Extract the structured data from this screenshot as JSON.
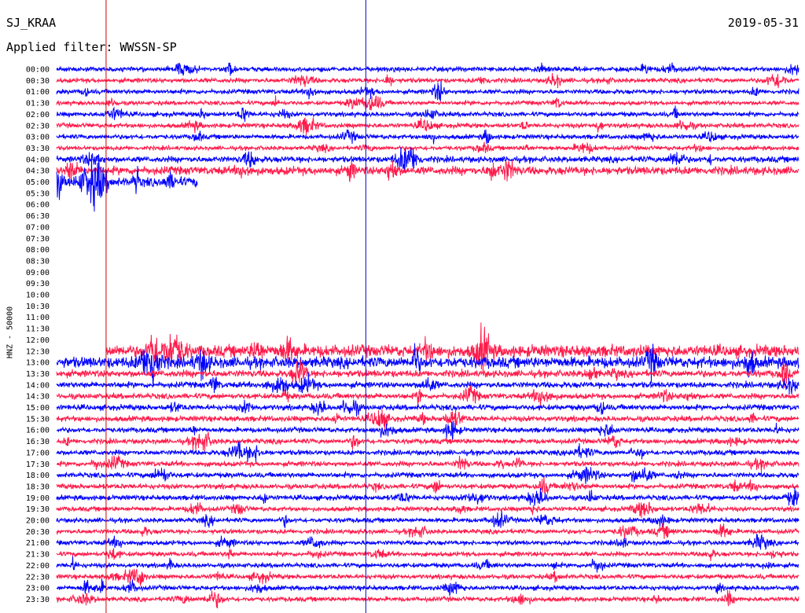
{
  "header": {
    "station": "SJ_KRAA",
    "date": "2019-05-31",
    "filter_label": "Applied filter: WWSSN-SP"
  },
  "chart_data": {
    "type": "line",
    "title": "SJ_KRAA",
    "subtitle": "Applied filter: WWSSN-SP",
    "date": "2019-05-31",
    "ylabel": "HNZ - 50000",
    "colors": {
      "even_row": "#0000ff",
      "odd_row": "#ff1a4a",
      "marker_a": "#cc0000",
      "marker_b": "#0000cc"
    },
    "row_labels": [
      "00:00",
      "00:30",
      "01:00",
      "01:30",
      "02:00",
      "02:30",
      "03:00",
      "03:30",
      "04:00",
      "04:30",
      "05:00",
      "05:30",
      "06:00",
      "06:30",
      "07:00",
      "07:30",
      "08:00",
      "08:30",
      "09:00",
      "09:30",
      "10:00",
      "10:30",
      "11:00",
      "11:30",
      "12:00",
      "12:30",
      "13:00",
      "13:30",
      "14:00",
      "14:30",
      "15:00",
      "15:30",
      "16:00",
      "16:30",
      "17:00",
      "17:30",
      "18:00",
      "18:30",
      "19:00",
      "19:30",
      "20:00",
      "20:30",
      "21:00",
      "21:30",
      "22:00",
      "22:30",
      "23:00",
      "23:30"
    ],
    "x_minutes": [
      0,
      30
    ],
    "vertical_markers_minute": [
      2,
      12.5
    ],
    "traces": [
      {
        "row": "00:00",
        "start_min": 0,
        "end_min": 30,
        "amplitude": 1.0
      },
      {
        "row": "00:30",
        "start_min": 0,
        "end_min": 30,
        "amplitude": 1.0
      },
      {
        "row": "01:00",
        "start_min": 0,
        "end_min": 30,
        "amplitude": 1.0
      },
      {
        "row": "01:30",
        "start_min": 0,
        "end_min": 30,
        "amplitude": 0.9
      },
      {
        "row": "02:00",
        "start_min": 0,
        "end_min": 30,
        "amplitude": 1.0
      },
      {
        "row": "02:30",
        "start_min": 0,
        "end_min": 30,
        "amplitude": 1.0
      },
      {
        "row": "03:00",
        "start_min": 0,
        "end_min": 30,
        "amplitude": 1.0
      },
      {
        "row": "03:30",
        "start_min": 0,
        "end_min": 30,
        "amplitude": 0.9
      },
      {
        "row": "04:00",
        "start_min": 0,
        "end_min": 30,
        "amplitude": 1.3
      },
      {
        "row": "04:30",
        "start_min": 0,
        "end_min": 30,
        "amplitude": 1.8
      },
      {
        "row": "05:00",
        "start_min": 0,
        "end_min": 5.7,
        "amplitude": 2.0
      },
      {
        "row": "12:30",
        "start_min": 2,
        "end_min": 30,
        "amplitude": 2.6
      },
      {
        "row": "13:00",
        "start_min": 0,
        "end_min": 30,
        "amplitude": 2.4
      },
      {
        "row": "13:30",
        "start_min": 0,
        "end_min": 30,
        "amplitude": 1.5
      },
      {
        "row": "14:00",
        "start_min": 0,
        "end_min": 30,
        "amplitude": 1.3
      },
      {
        "row": "14:30",
        "start_min": 0,
        "end_min": 30,
        "amplitude": 1.2
      },
      {
        "row": "15:00",
        "start_min": 0,
        "end_min": 30,
        "amplitude": 1.2
      },
      {
        "row": "15:30",
        "start_min": 0,
        "end_min": 30,
        "amplitude": 1.2
      },
      {
        "row": "16:00",
        "start_min": 0,
        "end_min": 30,
        "amplitude": 1.1
      },
      {
        "row": "16:30",
        "start_min": 0,
        "end_min": 30,
        "amplitude": 1.1
      },
      {
        "row": "17:00",
        "start_min": 0,
        "end_min": 30,
        "amplitude": 1.1
      },
      {
        "row": "17:30",
        "start_min": 0,
        "end_min": 30,
        "amplitude": 1.1
      },
      {
        "row": "18:00",
        "start_min": 0,
        "end_min": 30,
        "amplitude": 1.1
      },
      {
        "row": "18:30",
        "start_min": 0,
        "end_min": 30,
        "amplitude": 1.1
      },
      {
        "row": "19:00",
        "start_min": 0,
        "end_min": 30,
        "amplitude": 1.1
      },
      {
        "row": "19:30",
        "start_min": 0,
        "end_min": 30,
        "amplitude": 1.0
      },
      {
        "row": "20:00",
        "start_min": 0,
        "end_min": 30,
        "amplitude": 1.0
      },
      {
        "row": "20:30",
        "start_min": 0,
        "end_min": 30,
        "amplitude": 1.0
      },
      {
        "row": "21:00",
        "start_min": 0,
        "end_min": 30,
        "amplitude": 1.0
      },
      {
        "row": "21:30",
        "start_min": 0,
        "end_min": 30,
        "amplitude": 1.0
      },
      {
        "row": "22:00",
        "start_min": 0,
        "end_min": 30,
        "amplitude": 1.0
      },
      {
        "row": "22:30",
        "start_min": 0,
        "end_min": 30,
        "amplitude": 1.0
      },
      {
        "row": "23:00",
        "start_min": 0,
        "end_min": 30,
        "amplitude": 1.0
      },
      {
        "row": "23:30",
        "start_min": 0,
        "end_min": 30,
        "amplitude": 1.0
      }
    ]
  }
}
